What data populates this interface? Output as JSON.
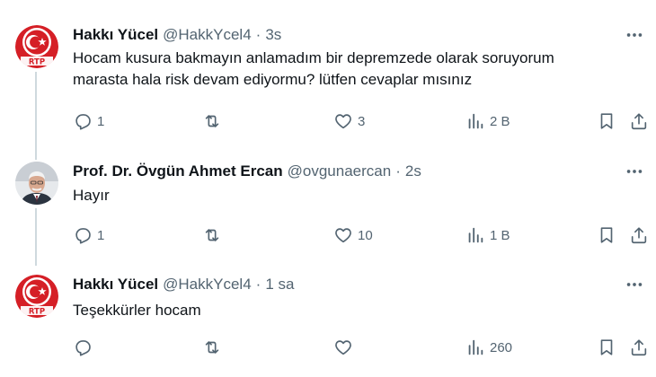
{
  "tweets": [
    {
      "name": "Hakkı Yücel",
      "handle": "@HakkYcel4",
      "separator": "·",
      "time": "3s",
      "text_lines": [
        "Hocam kusura bakmayın anlamadım bir depremzede olarak soruyorum",
        "marasta hala risk devam ediyormu? lütfen cevaplar mısınız"
      ],
      "replies": "1",
      "retweets": "",
      "likes": "3",
      "views": "2 B",
      "avatar": "turkish-crescent-star-logo",
      "avatar_text": "RTP"
    },
    {
      "name": "Prof. Dr. Övgün Ahmet Ercan",
      "handle": "@ovgunaercan",
      "separator": "·",
      "time": "2s",
      "text_lines": [
        "Hayır"
      ],
      "replies": "1",
      "retweets": "",
      "likes": "10",
      "views": "1 B",
      "avatar": "profile-photo"
    },
    {
      "name": "Hakkı Yücel",
      "handle": "@HakkYcel4",
      "separator": "·",
      "time": "1 sa",
      "text_lines": [
        "Teşekkürler hocam"
      ],
      "replies": "",
      "retweets": "",
      "likes": "",
      "views": "260",
      "avatar": "turkish-crescent-star-logo",
      "avatar_text": "RTP"
    }
  ],
  "colors": {
    "text": "#0f1419",
    "secondary": "#536471",
    "thread_line": "#cfd9de",
    "logo_red": "#d51f26"
  },
  "icons": [
    "reply-icon",
    "retweet-icon",
    "like-icon",
    "views-icon",
    "bookmark-icon",
    "share-icon",
    "more-icon"
  ]
}
